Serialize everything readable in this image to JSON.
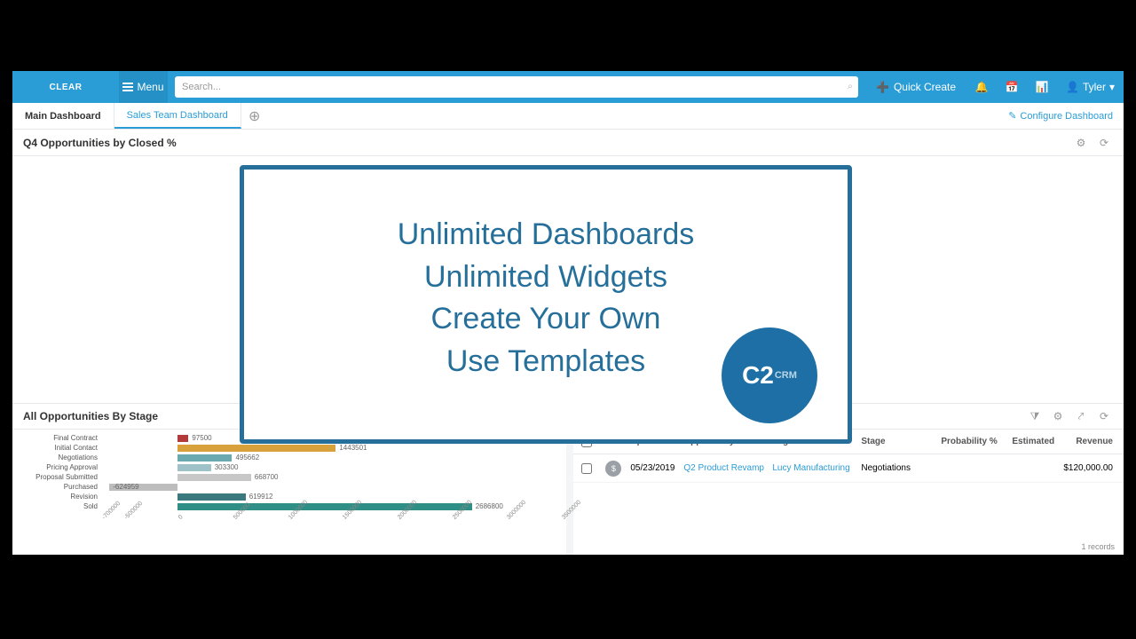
{
  "topbar": {
    "logo_text": "CLEAR",
    "menu_label": "Menu",
    "search_placeholder": "Search...",
    "quick_create_label": "Quick Create",
    "user_name": "Tyler"
  },
  "tabs": {
    "items": [
      {
        "label": "Main Dashboard",
        "active": true
      },
      {
        "label": "Sales Team Dashboard",
        "active": false
      }
    ],
    "configure_label": "Configure Dashboard"
  },
  "widget1": {
    "title": "Q4 Opportunities by Closed %"
  },
  "widget2": {
    "title": "All Opportunities By Stage"
  },
  "chart_data": {
    "type": "bar",
    "orientation": "horizontal",
    "categories": [
      "Final Contract",
      "Initial Contact",
      "Negotiations",
      "Pricing Approval",
      "Proposal Submitted",
      "Purchased",
      "Revision",
      "Sold"
    ],
    "values": [
      97500,
      1443501,
      495662,
      303300,
      668700,
      -624959,
      619912,
      2686800
    ],
    "colors": [
      "#b33a3a",
      "#d8a13c",
      "#6aa9b0",
      "#9ec2c7",
      "#c7c7c7",
      "#bdbdbd",
      "#3a7a7e",
      "#2f8f86"
    ],
    "title": "All Opportunities By Stage",
    "xlabel": "",
    "ylabel": "",
    "xlim": [
      -700000,
      3500000
    ],
    "x_ticks": [
      "-700000",
      "-500000",
      "0",
      "500000",
      "1000000",
      "1500000",
      "2000000",
      "2500000",
      "3000000",
      "3500000"
    ]
  },
  "grid": {
    "columns": [
      "",
      "",
      "Updated O",
      "Opportunity Name",
      "Organization",
      "Stage",
      "Probability %",
      "Estimated",
      "Revenue"
    ],
    "rows": [
      {
        "updated": "05/23/2019",
        "name": "Q2 Product Revamp",
        "organization": "Lucy Manufacturing",
        "stage": "Negotiations",
        "probability": "",
        "estimated": "",
        "revenue": "$120,000.00",
        "avatar": "$"
      }
    ],
    "footer": "1 records"
  },
  "overlay": {
    "lines": [
      "Unlimited Dashboards",
      "Unlimited Widgets",
      "Create Your Own",
      "Use Templates"
    ],
    "logo_main": "C2",
    "logo_sub": "CRM"
  }
}
